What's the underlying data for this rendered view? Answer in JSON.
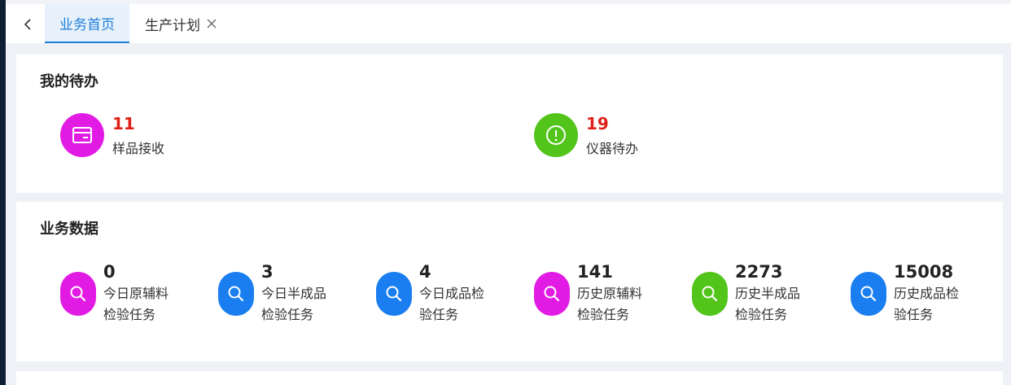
{
  "tabs": [
    {
      "label": "业务首页",
      "active": true
    },
    {
      "label": "生产计划",
      "active": false,
      "closable": true
    }
  ],
  "todo": {
    "title": "我的待办",
    "items": [
      {
        "count": "11",
        "label": "样品接收",
        "icon": "card-icon",
        "color": "#e21be4"
      },
      {
        "count": "19",
        "label": "仪器待办",
        "icon": "alert-icon",
        "color": "#52c41a"
      }
    ]
  },
  "business": {
    "title": "业务数据",
    "items": [
      {
        "count": "0",
        "label": "今日原辅料检验任务",
        "icon": "search-icon",
        "color": "#e21be4"
      },
      {
        "count": "3",
        "label": "今日半成品检验任务",
        "icon": "search-icon",
        "color": "#1a7ef0"
      },
      {
        "count": "4",
        "label": "今日成品检验任务",
        "icon": "search-icon",
        "color": "#1a7ef0"
      },
      {
        "count": "141",
        "label": "历史原辅料检验任务",
        "icon": "search-icon",
        "color": "#e21be4"
      },
      {
        "count": "2273",
        "label": "历史半成品检验任务",
        "icon": "search-icon",
        "color": "#52c41a"
      },
      {
        "count": "15008",
        "label": "历史成品检验任务",
        "icon": "search-icon",
        "color": "#1a7ef0"
      }
    ]
  }
}
